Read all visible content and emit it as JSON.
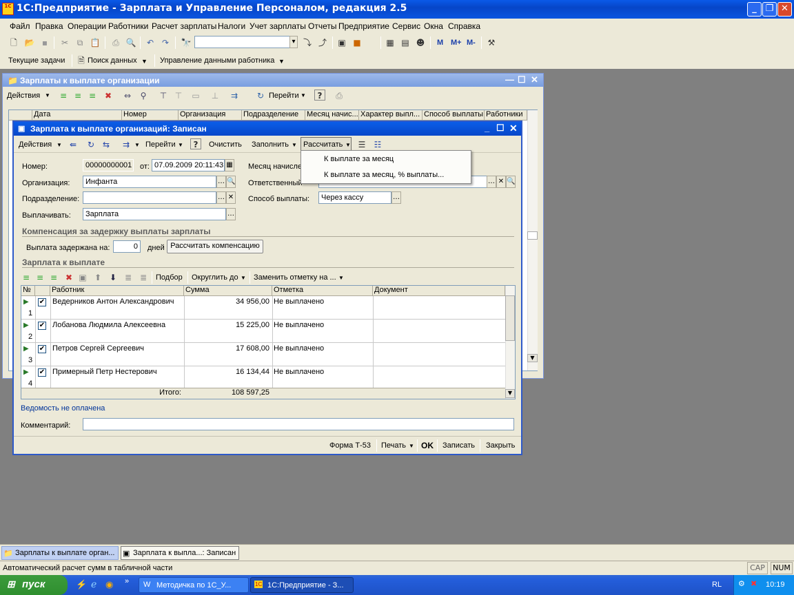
{
  "app": {
    "icon": "1С",
    "title": "1С:Предприятие - Зарплата и Управление Персоналом, редакция 2.5",
    "win_controls": [
      "_",
      "❐",
      "✕"
    ]
  },
  "menu": [
    "Файл",
    "Правка",
    "Операции",
    "Работники",
    "Расчет зарплаты",
    "Налоги",
    "Учет зарплаты",
    "Отчеты",
    "Предприятие",
    "Сервис",
    "Окна",
    "Справка"
  ],
  "toolbar2": {
    "items": [
      "Текущие задачи",
      "Поиск данных",
      "Управление данными работника"
    ],
    "styles": [
      "M",
      "M+",
      "M-"
    ]
  },
  "back_window": {
    "title": "Зарплаты к выплате организации",
    "toolbar": {
      "actions": "Действия",
      "goto": "Перейти"
    },
    "columns": [
      "Дата",
      "Номер",
      "Организация",
      "Подразделение",
      "Месяц начис...",
      "Характер выпл...",
      "Способ выплаты",
      "Работники"
    ]
  },
  "doc": {
    "title": "Зарплата к выплате организаций: Записан",
    "toolbar": {
      "actions": "Действия",
      "goto": "Перейти",
      "clear": "Очистить",
      "fill": "Заполнить",
      "calculate": "Рассчитать",
      "help": "?"
    },
    "dropdown": [
      "К выплате за месяц",
      "К выплате за месяц, % выплаты..."
    ],
    "number_label": "Номер:",
    "number": "00000000001",
    "date_label": "от:",
    "date": "07.09.2009 20:11:43",
    "month_label": "Месяц начисле",
    "org_label": "Организация:",
    "org": "Инфанта",
    "resp_label": "Ответственный",
    "dept_label": "Подразделение:",
    "dept": "",
    "pay_method_label": "Способ выплаты:",
    "pay_method": "Через кассу",
    "pay_label": "Выплачивать:",
    "pay": "Зарплата",
    "comp_section": "Компенсация за задержку выплаты зарплаты",
    "delay_label": "Выплата задержана на:",
    "delay_value": "0",
    "delay_unit": "дней",
    "calc_comp_button": "Рассчитать компенсацию",
    "salary_section": "Зарплата к выплате",
    "grid_toolbar": {
      "select": "Подбор",
      "round": "Округлить до",
      "replace": "Заменить отметку на ..."
    },
    "grid_columns": [
      "№",
      "Работник",
      "Сумма",
      "Отметка",
      "Документ"
    ],
    "rows": [
      {
        "n": "1",
        "name": "Ведерников Антон Александрович",
        "sum": "34 956,00",
        "mark": "Не выплачено"
      },
      {
        "n": "2",
        "name": "Лобанова Людмила Алексеевна",
        "sum": "15 225,00",
        "mark": "Не выплачено"
      },
      {
        "n": "3",
        "name": "Петров Сергей Сергеевич",
        "sum": "17 608,00",
        "mark": "Не выплачено"
      },
      {
        "n": "4",
        "name": "Примерный Петр Нестерович",
        "sum": "16 134,44",
        "mark": "Не выплачено"
      }
    ],
    "total_label": "Итого:",
    "total": "108 597,25",
    "status_link": "Ведомость не оплачена",
    "comment_label": "Комментарий:",
    "bottom": {
      "form": "Форма Т-53",
      "print": "Печать",
      "ok": "OK",
      "save": "Записать",
      "close": "Закрыть"
    }
  },
  "mdi_tabs": [
    "Зарплаты к выплате орган...",
    "Зарплата к выпла...: Записан"
  ],
  "statusbar": {
    "text": "Автоматический расчет сумм в табличной части",
    "cap": "CAP",
    "num": "NUM"
  },
  "taskbar": {
    "start": "пуск",
    "tasks": [
      "Методичка по 1С_У...",
      "1С:Предприятие - З..."
    ],
    "lang": "RL",
    "time": "10:19"
  }
}
